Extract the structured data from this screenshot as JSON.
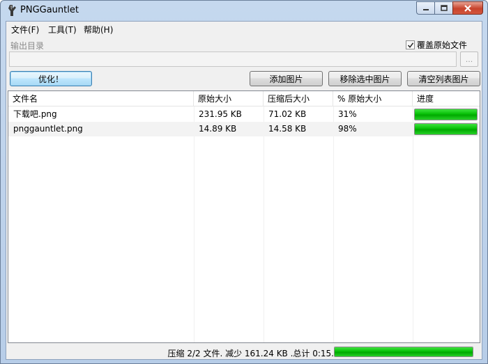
{
  "window": {
    "title": "PNGGauntlet"
  },
  "menu": [
    {
      "label": "文件(F)"
    },
    {
      "label": "工具(T)"
    },
    {
      "label": "帮助(H)"
    }
  ],
  "output": {
    "label": "输出目录",
    "value": "",
    "browse_label": "...",
    "overwrite_label": "覆盖原始文件",
    "overwrite_checked": true
  },
  "toolbar": {
    "optimize_label": "优化！",
    "add_label": "添加图片",
    "remove_label": "移除选中图片",
    "clear_label": "清空列表图片"
  },
  "table": {
    "columns": [
      "文件名",
      "原始大小",
      "压缩后大小",
      "% 原始大小",
      "进度"
    ],
    "rows": [
      {
        "name": "下载吧.png",
        "original": "231.95 KB",
        "compressed": "71.02 KB",
        "percent": "31%",
        "progress": 100
      },
      {
        "name": "pnggauntlet.png",
        "original": "14.89 KB",
        "compressed": "14.58 KB",
        "percent": "98%",
        "progress": 100
      }
    ]
  },
  "status": {
    "text": "压缩 2/2 文件. 减少 161.24 KB .总计 0:15.",
    "progress": 100
  },
  "colors": {
    "progress_green": "#07c107",
    "accent_blue": "#3c7fb1"
  }
}
